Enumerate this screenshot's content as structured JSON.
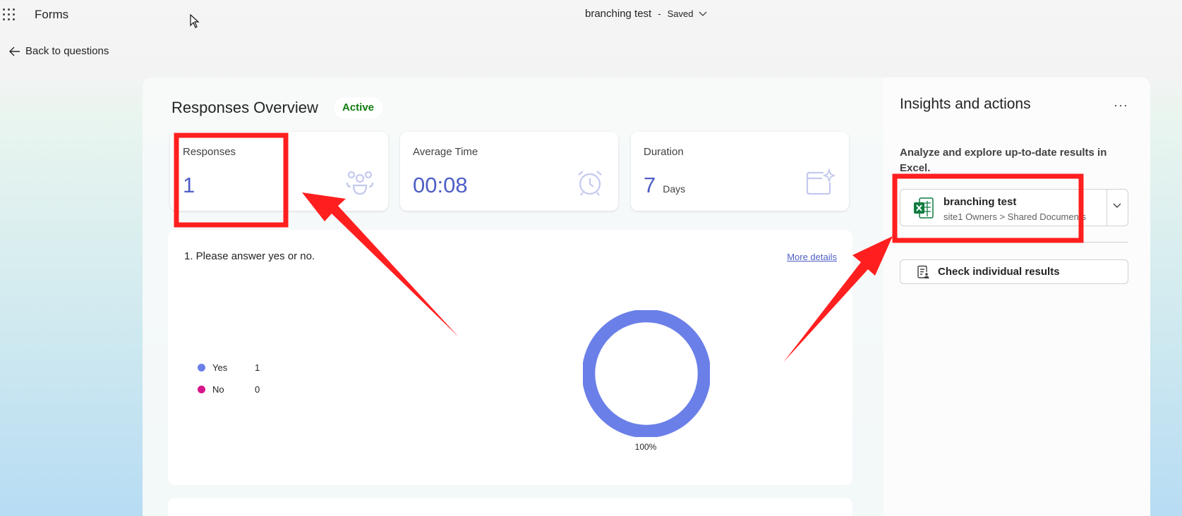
{
  "header": {
    "app_name": "Forms",
    "doc_title": "branching test",
    "separator": "-",
    "save_status": "Saved"
  },
  "nav": {
    "back_label": "Back to questions"
  },
  "overview": {
    "title": "Responses Overview",
    "status_badge": "Active",
    "stats": [
      {
        "label": "Responses",
        "value": "1",
        "unit": "",
        "icon": "people-icon"
      },
      {
        "label": "Average Time",
        "value": "00:08",
        "unit": "",
        "icon": "alarm-clock-icon"
      },
      {
        "label": "Duration",
        "value": "7",
        "unit": "Days",
        "icon": "calendar-sparkle-icon"
      }
    ]
  },
  "question": {
    "title": "1. Please answer yes or no.",
    "more_details": "More details",
    "options": [
      {
        "label": "Yes",
        "count": "1",
        "color": "#6b7fe8"
      },
      {
        "label": "No",
        "count": "0",
        "color": "#d6168b"
      }
    ],
    "donut_label": "100%"
  },
  "chart_data": {
    "type": "pie",
    "categories": [
      "Yes",
      "No"
    ],
    "values": [
      1,
      0
    ],
    "colors": [
      "#6b7fe8",
      "#d6168b"
    ],
    "annotations": [
      "100%"
    ],
    "legend_placement": "left"
  },
  "insights": {
    "title": "Insights and actions",
    "more_label": "···",
    "description": "Analyze and explore up-to-date results in Excel.",
    "excel_file": {
      "name": "branching test",
      "path": "site1 Owners > Shared Documents"
    },
    "check_results_label": "Check individual results"
  },
  "colors": {
    "accent": "#4f5fc6",
    "annotation_red": "#ff1f1f",
    "excel_green": "#107c41"
  }
}
